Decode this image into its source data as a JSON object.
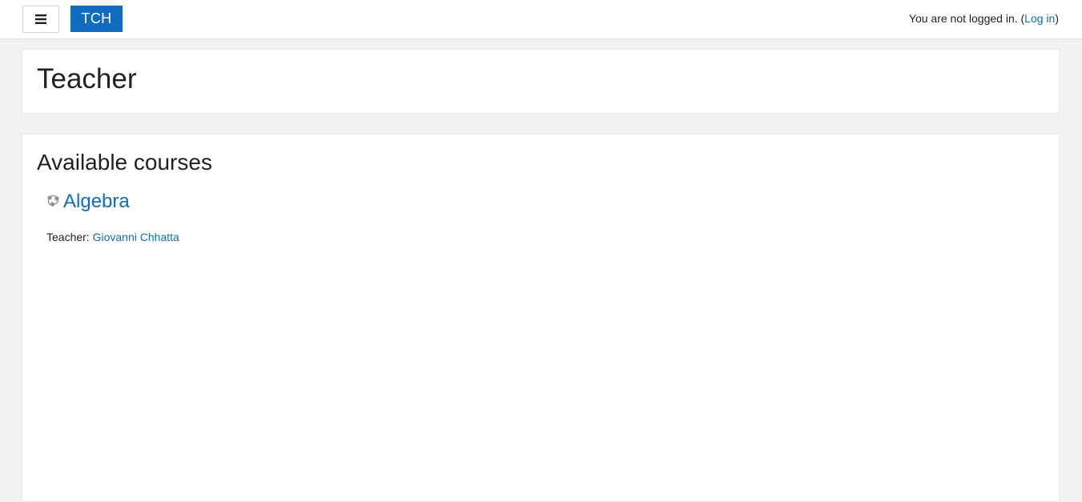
{
  "navbar": {
    "menu_icon": "hamburger-icon",
    "brand_label": "TCH",
    "login_status_prefix": "You are not logged in. (",
    "login_link_label": "Log in",
    "login_status_suffix": ")"
  },
  "page_header": {
    "title": "Teacher"
  },
  "main": {
    "section_title": "Available courses",
    "courses": [
      {
        "icon": "course-icon",
        "name": "Algebra",
        "teacher_label": "Teacher: ",
        "teacher_name": "Giovanni Chhatta"
      }
    ]
  },
  "colors": {
    "accent": "#0f6cbf",
    "page_background": "#f2f2f2",
    "card_background": "#ffffff",
    "text": "#1d2125"
  }
}
